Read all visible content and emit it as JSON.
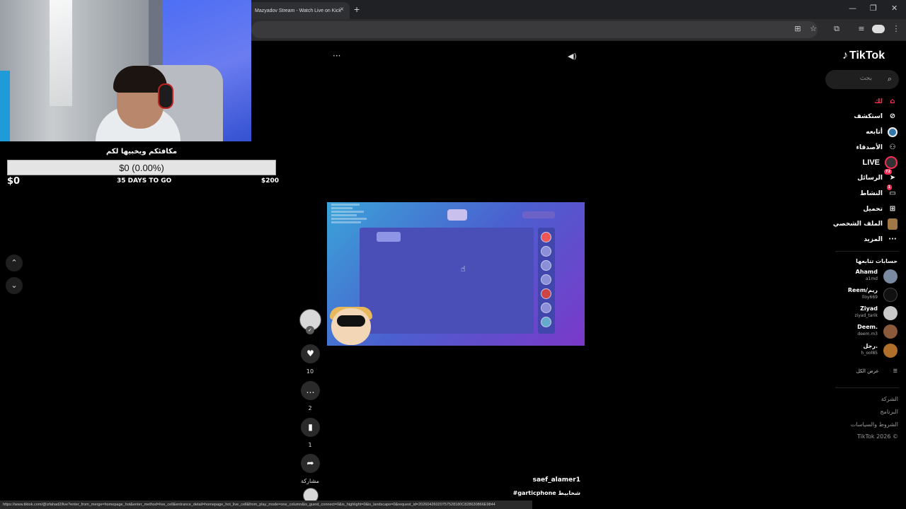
{
  "browser": {
    "tab_title": "Mazyadov Stream - Watch Live on Kick",
    "tab_close": "×",
    "new_tab": "+",
    "minimize": "—",
    "restore": "❐",
    "close": "✕",
    "status_url": "https://www.tiktok.com/@izfahad2/live?enter_from_merge=homepage_hot&enter_method=live_cell&entrance_detail=homepage_hot_live_cell&from_play_mode=one_column&is_guest_connect=0&is_highlight=0&is_landscape=0&request_id=20260426020757528180C828630866E9844"
  },
  "goal": {
    "title": "مكافئكم ويخبيها لكم",
    "amount_text": "$0 (0.00%)",
    "min_label": "$0",
    "days_left": "35 DAYS TO GO",
    "max_label": "$200",
    "progress": 0.0
  },
  "player": {
    "more": "···",
    "cursor": "☝"
  },
  "actions": {
    "likes": "10",
    "comments": "2",
    "bookmarks": "1",
    "share_label": "مشاركة"
  },
  "caption": {
    "username": "saef_alamer1",
    "tags": "#garticphone شخابيط"
  },
  "sidebar": {
    "logo": "TikTok",
    "search_placeholder": "بحث",
    "nav": [
      {
        "label": "لك",
        "icon": "home-icon"
      },
      {
        "label": "استكشف",
        "icon": "compass-icon"
      },
      {
        "label": "أتابعه",
        "icon": "following-icon"
      },
      {
        "label": "الأصدقاء",
        "icon": "friends-icon"
      },
      {
        "label": "LIVE",
        "icon": "live-icon"
      },
      {
        "label": "الرسائل",
        "icon": "messages-icon",
        "badge": "72"
      },
      {
        "label": "النشاط",
        "icon": "activity-icon",
        "badge": "1"
      },
      {
        "label": "تحميل",
        "icon": "upload-icon"
      },
      {
        "label": "الملف الشخصي",
        "icon": "profile-icon"
      },
      {
        "label": "المزيد",
        "icon": "more-icon"
      }
    ],
    "following_title": "حسابات تتابعها",
    "accounts": [
      {
        "name": "Ahamd",
        "handle": "a1md"
      },
      {
        "name": "Reem/ريم",
        "handle": "lloy669"
      },
      {
        "name": "Ziyad",
        "handle": "ziyad_tarik"
      },
      {
        "name": "Deem.",
        "handle": "deem.m3"
      },
      {
        "name": "رجل.",
        "handle": "h_ool85"
      }
    ],
    "see_all": "عرض الكل",
    "footer": [
      "الشركة",
      "البرنامج",
      "الشروط والسياسات",
      "TikTok 2026 ©"
    ]
  }
}
